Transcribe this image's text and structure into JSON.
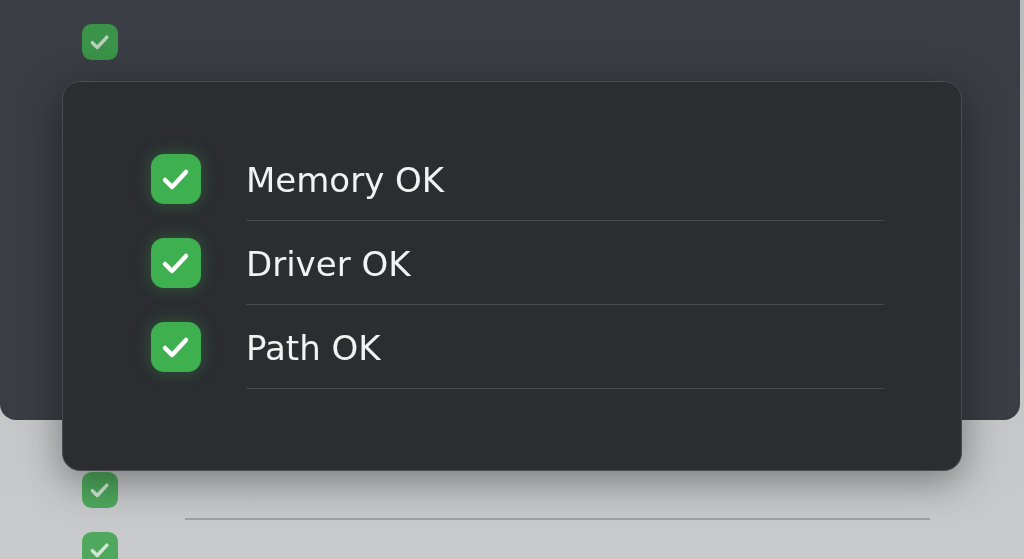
{
  "background": {
    "upper_items": [
      {
        "checked": true
      }
    ],
    "lower_items": [
      {
        "checked": true
      },
      {
        "checked": true
      }
    ]
  },
  "dialog": {
    "items": [
      {
        "label": "Memory OK",
        "checked": true
      },
      {
        "label": "Driver OK",
        "checked": true
      },
      {
        "label": "Path OK",
        "checked": true
      }
    ]
  }
}
